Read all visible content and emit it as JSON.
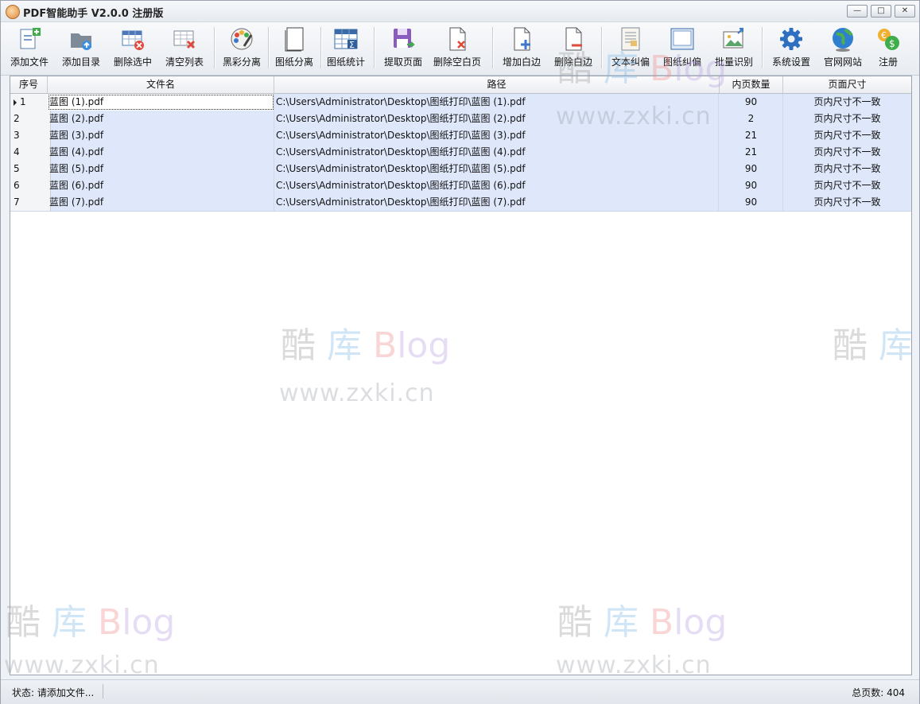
{
  "window": {
    "title": "PDF智能助手 V2.0.0 注册版"
  },
  "toolbar": {
    "buttons": [
      {
        "label": "添加文件",
        "icon": "add-file-icon"
      },
      {
        "label": "添加目录",
        "icon": "add-folder-icon"
      },
      {
        "label": "删除选中",
        "icon": "delete-selected-icon"
      },
      {
        "label": "清空列表",
        "icon": "clear-list-icon"
      },
      {
        "label": "黑彩分离",
        "icon": "color-palette-icon"
      },
      {
        "label": "图纸分离",
        "icon": "drawing-split-icon"
      },
      {
        "label": "图纸统计",
        "icon": "drawing-stats-icon"
      },
      {
        "label": "提取页面",
        "icon": "extract-page-icon"
      },
      {
        "label": "删除空白页",
        "icon": "delete-blank-page-icon"
      },
      {
        "label": "增加白边",
        "icon": "add-margin-icon"
      },
      {
        "label": "删除白边",
        "icon": "remove-margin-icon"
      },
      {
        "label": "文本纠偏",
        "icon": "text-deskew-icon"
      },
      {
        "label": "图纸纠偏",
        "icon": "drawing-deskew-icon"
      },
      {
        "label": "批量识别",
        "icon": "batch-recognize-icon"
      },
      {
        "label": "系统设置",
        "icon": "gear-icon"
      },
      {
        "label": "官网网站",
        "icon": "globe-icon"
      },
      {
        "label": "注册",
        "icon": "register-coins-icon"
      }
    ]
  },
  "table": {
    "headers": {
      "num": "序号",
      "name": "文件名",
      "path": "路径",
      "pages": "内页数量",
      "size": "页面尺寸"
    },
    "rows": [
      {
        "num": "1",
        "name": "蓝图 (1).pdf",
        "path": "C:\\Users\\Administrator\\Desktop\\图纸打印\\蓝图 (1).pdf",
        "pages": "90",
        "size": "页内尺寸不一致"
      },
      {
        "num": "2",
        "name": "蓝图 (2).pdf",
        "path": "C:\\Users\\Administrator\\Desktop\\图纸打印\\蓝图 (2).pdf",
        "pages": "2",
        "size": "页内尺寸不一致"
      },
      {
        "num": "3",
        "name": "蓝图 (3).pdf",
        "path": "C:\\Users\\Administrator\\Desktop\\图纸打印\\蓝图 (3).pdf",
        "pages": "21",
        "size": "页内尺寸不一致"
      },
      {
        "num": "4",
        "name": "蓝图 (4).pdf",
        "path": "C:\\Users\\Administrator\\Desktop\\图纸打印\\蓝图 (4).pdf",
        "pages": "21",
        "size": "页内尺寸不一致"
      },
      {
        "num": "5",
        "name": "蓝图 (5).pdf",
        "path": "C:\\Users\\Administrator\\Desktop\\图纸打印\\蓝图 (5).pdf",
        "pages": "90",
        "size": "页内尺寸不一致"
      },
      {
        "num": "6",
        "name": "蓝图 (6).pdf",
        "path": "C:\\Users\\Administrator\\Desktop\\图纸打印\\蓝图 (6).pdf",
        "pages": "90",
        "size": "页内尺寸不一致"
      },
      {
        "num": "7",
        "name": "蓝图 (7).pdf",
        "path": "C:\\Users\\Administrator\\Desktop\\图纸打印\\蓝图 (7).pdf",
        "pages": "90",
        "size": "页内尺寸不一致"
      }
    ]
  },
  "watermark": {
    "brand_a": "酷",
    "brand_b": "库",
    "brand_c": "B",
    "brand_d": "log",
    "url": "www.zxki.cn"
  },
  "status": {
    "left": "状态: 请添加文件...",
    "right": "总页数: 404"
  },
  "colors": {
    "row_bg": "#dfe8fb",
    "accent": "#3c78c8"
  }
}
